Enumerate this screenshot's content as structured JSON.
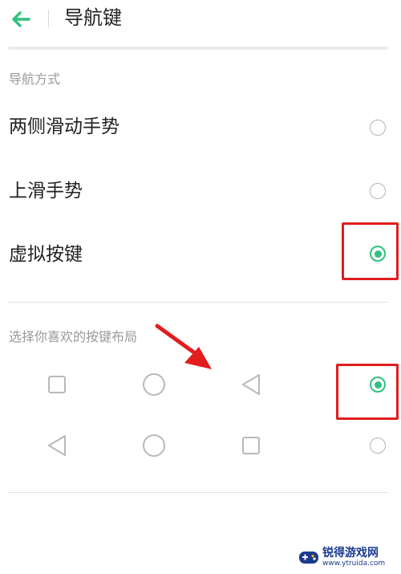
{
  "header": {
    "title": "导航键"
  },
  "nav_section": {
    "label": "导航方式",
    "options": [
      {
        "label": "两侧滑动手势",
        "selected": false
      },
      {
        "label": "上滑手势",
        "selected": false
      },
      {
        "label": "虚拟按键",
        "selected": true
      }
    ]
  },
  "layout_section": {
    "label": "选择你喜欢的按键布局",
    "layouts": [
      {
        "icons": [
          "square-icon",
          "circle-icon",
          "triangle-left-icon"
        ],
        "selected": true
      },
      {
        "icons": [
          "triangle-left-icon",
          "circle-icon",
          "square-icon"
        ],
        "selected": false
      }
    ]
  },
  "watermark": {
    "name": "锐得游戏网",
    "url": "www.ytruida.com"
  },
  "colors": {
    "accent": "#2ec27e",
    "highlight": "#e11d1d",
    "text": "#222222",
    "muted": "#9a9a9a"
  }
}
